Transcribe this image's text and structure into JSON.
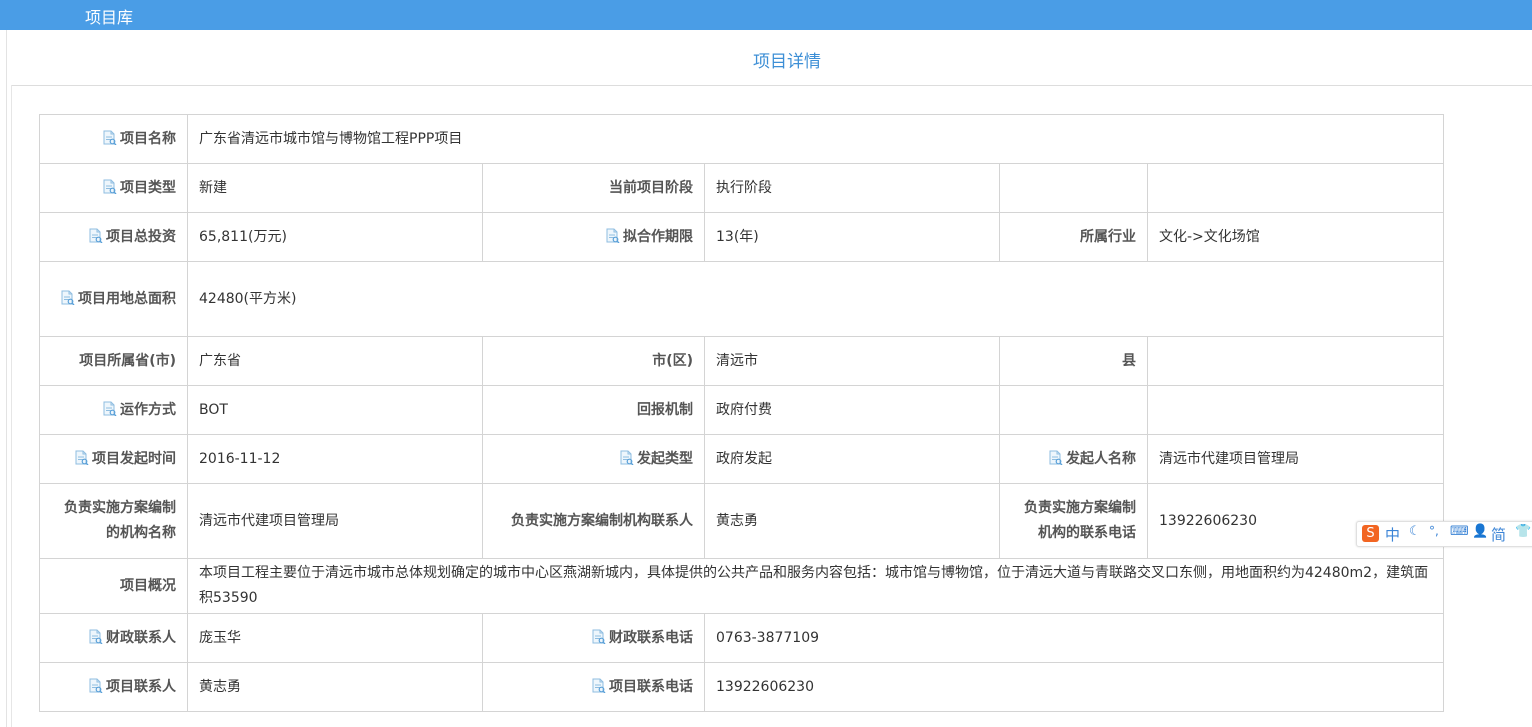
{
  "header": {
    "title": "项目库"
  },
  "page": {
    "heading": "项目详情"
  },
  "colors": {
    "header_bg": "#4a9de6",
    "heading_text": "#3d8fd6",
    "border": "#d4d4d4"
  },
  "fields": {
    "name": {
      "label": "项目名称",
      "value": "广东省清远市城市馆与博物馆工程PPP项目"
    },
    "type": {
      "label": "项目类型",
      "value": "新建"
    },
    "stage": {
      "label": "当前项目阶段",
      "value": "执行阶段"
    },
    "investment": {
      "label": "项目总投资",
      "value": "65,811(万元)"
    },
    "period": {
      "label": "拟合作期限",
      "value": "13(年)"
    },
    "industry": {
      "label": "所属行业",
      "value": "文化->文化场馆"
    },
    "land_area": {
      "label": "项目用地总面积",
      "value": "42480(平方米)"
    },
    "province": {
      "label": "项目所属省(市)",
      "value": "广东省"
    },
    "city": {
      "label": "市(区)",
      "value": "清远市"
    },
    "county": {
      "label": "县",
      "value": ""
    },
    "operation": {
      "label": "运作方式",
      "value": "BOT"
    },
    "return": {
      "label": "回报机制",
      "value": "政府付费"
    },
    "launch_date": {
      "label": "项目发起时间",
      "value": "2016-11-12"
    },
    "launch_type": {
      "label": "发起类型",
      "value": "政府发起"
    },
    "initiator": {
      "label": "发起人名称",
      "value": "清远市代建项目管理局"
    },
    "plan_org": {
      "label": "负责实施方案编制的机构名称",
      "value": "清远市代建项目管理局"
    },
    "plan_contact": {
      "label": "负责实施方案编制机构联系人",
      "value": "黄志勇"
    },
    "plan_phone": {
      "label": "负责实施方案编制机构的联系电话",
      "value": "13922606230"
    },
    "overview": {
      "label": "项目概况",
      "value": "本项目工程主要位于清远市城市总体规划确定的城市中心区燕湖新城内，具体提供的公共产品和服务内容包括：城市馆与博物馆，位于清远大道与青联路交叉口东侧，用地面积约为42480m2，建筑面积53590"
    },
    "finance_contact": {
      "label": "财政联系人",
      "value": "庞玉华"
    },
    "finance_phone": {
      "label": "财政联系电话",
      "value": "0763-3877109"
    },
    "project_contact": {
      "label": "项目联系人",
      "value": "黄志勇"
    },
    "project_phone": {
      "label": "项目联系电话",
      "value": "13922606230"
    }
  },
  "ime_toolbar": {
    "items": [
      "中",
      "简"
    ]
  },
  "icons": [
    "document-icon",
    "sogou-logo-icon",
    "moon-icon",
    "keyboard-icon",
    "user-icon",
    "shirt-icon"
  ]
}
